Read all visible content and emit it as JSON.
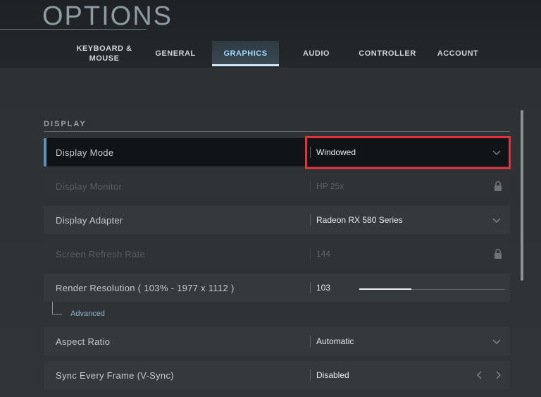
{
  "header": {
    "title": "OPTIONS",
    "tabs": [
      {
        "label": "KEYBOARD &\nMOUSE",
        "active": false
      },
      {
        "label": "GENERAL",
        "active": false
      },
      {
        "label": "GRAPHICS",
        "active": true
      },
      {
        "label": "AUDIO",
        "active": false
      },
      {
        "label": "CONTROLLER",
        "active": false
      },
      {
        "label": "ACCOUNT",
        "active": false
      }
    ]
  },
  "section": {
    "title": "DISPLAY"
  },
  "settings": [
    {
      "label": "Display Mode",
      "value": "Windowed",
      "control": "dropdown",
      "state": "selected"
    },
    {
      "label": "Display Monitor",
      "value": "HP 25x",
      "control": "locked",
      "state": "disabled"
    },
    {
      "label": "Display Adapter",
      "value": "Radeon RX 580 Series",
      "control": "dropdown",
      "state": "normal"
    },
    {
      "label": "Screen Refresh Rate",
      "value": "144",
      "control": "locked",
      "state": "disabled"
    },
    {
      "label": "Render Resolution ( 103% - 1977 x 1112 )",
      "value": "103",
      "control": "slider",
      "state": "normal",
      "slider_fraction": 0.36
    },
    {
      "label": "Aspect Ratio",
      "value": "Automatic",
      "control": "dropdown",
      "state": "normal"
    },
    {
      "label": "Sync Every Frame (V-Sync)",
      "value": "Disabled",
      "control": "arrows",
      "state": "normal"
    }
  ],
  "advanced": {
    "label": "Advanced"
  },
  "colors": {
    "highlight": "#e0323a",
    "accent": "#9fd8ff"
  }
}
